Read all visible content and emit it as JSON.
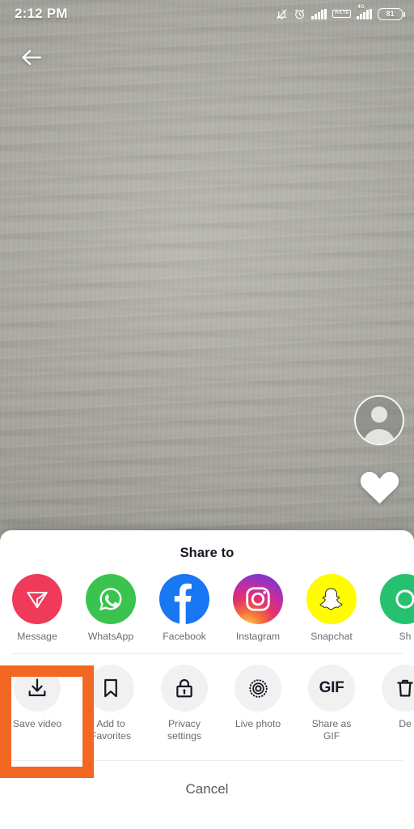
{
  "status_bar": {
    "time": "2:12 PM",
    "battery_level": "81",
    "volte_line1": "Vo",
    "volte_line2": "LTE",
    "network_label": "4G",
    "icons": [
      "bell-muted-icon",
      "alarm-clock-icon",
      "signal-bars-icon",
      "volte-badge",
      "signal-bars-4g-icon",
      "battery-icon"
    ]
  },
  "video": {
    "back_icon": "back-arrow-icon",
    "avatar_icon": "avatar-icon",
    "like_icon": "heart-icon"
  },
  "share_sheet": {
    "title": "Share to",
    "cancel_label": "Cancel",
    "apps": [
      {
        "label": "Message",
        "icon": "tiktok-message-icon",
        "color": "#ef3a5a"
      },
      {
        "label": "WhatsApp",
        "icon": "whatsapp-icon",
        "color": "#3ac34f"
      },
      {
        "label": "Facebook",
        "icon": "facebook-icon",
        "color": "#1877f2"
      },
      {
        "label": "Instagram",
        "icon": "instagram-icon",
        "color": "#d6249f"
      },
      {
        "label": "Snapchat",
        "icon": "snapchat-icon",
        "color": "#fffc00"
      },
      {
        "label": "Sh",
        "icon": "green-chat-icon",
        "color": "#25c16f"
      }
    ],
    "actions": [
      {
        "label": "Save video",
        "icon": "download-icon",
        "highlighted": true
      },
      {
        "label": "Add to\nFavorites",
        "icon": "bookmark-icon",
        "highlighted": false
      },
      {
        "label": "Privacy\nsettings",
        "icon": "lock-icon",
        "highlighted": false
      },
      {
        "label": "Live photo",
        "icon": "live-photo-icon",
        "highlighted": false
      },
      {
        "label": "Share as\nGIF",
        "icon": "gif-icon",
        "gif_text": "GIF",
        "highlighted": false
      },
      {
        "label": "De",
        "icon": "trash-icon",
        "highlighted": false
      }
    ]
  },
  "highlight": {
    "color": "#f26722",
    "target": "Save video"
  }
}
